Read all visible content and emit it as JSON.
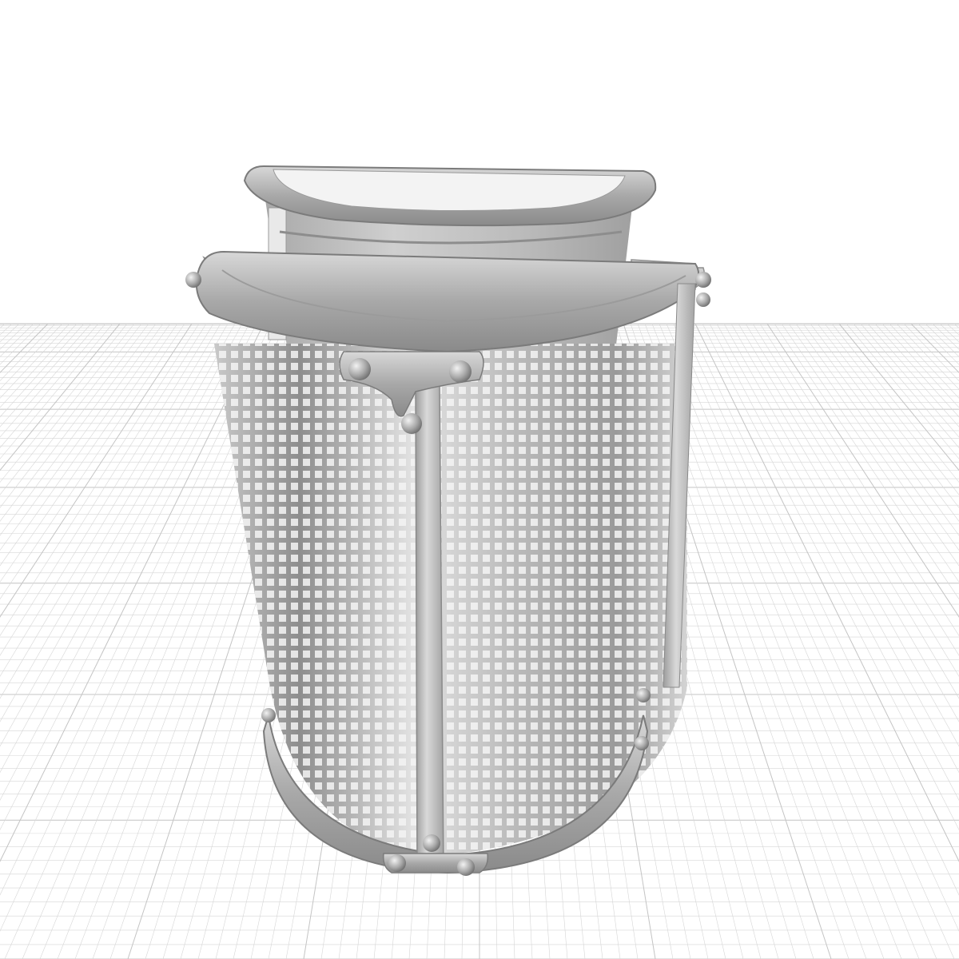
{
  "scene": {
    "background_color": "#ffffff",
    "grid_line_color": "#d6d6d6",
    "grid_major_color": "#c4c4c4",
    "model_base_color": "#b9b9b9",
    "model_dark_color": "#7a7a7a",
    "model_light_color": "#eeeeee",
    "objects": [
      "ground-grid",
      "perforated-basket",
      "inner-bin"
    ]
  }
}
